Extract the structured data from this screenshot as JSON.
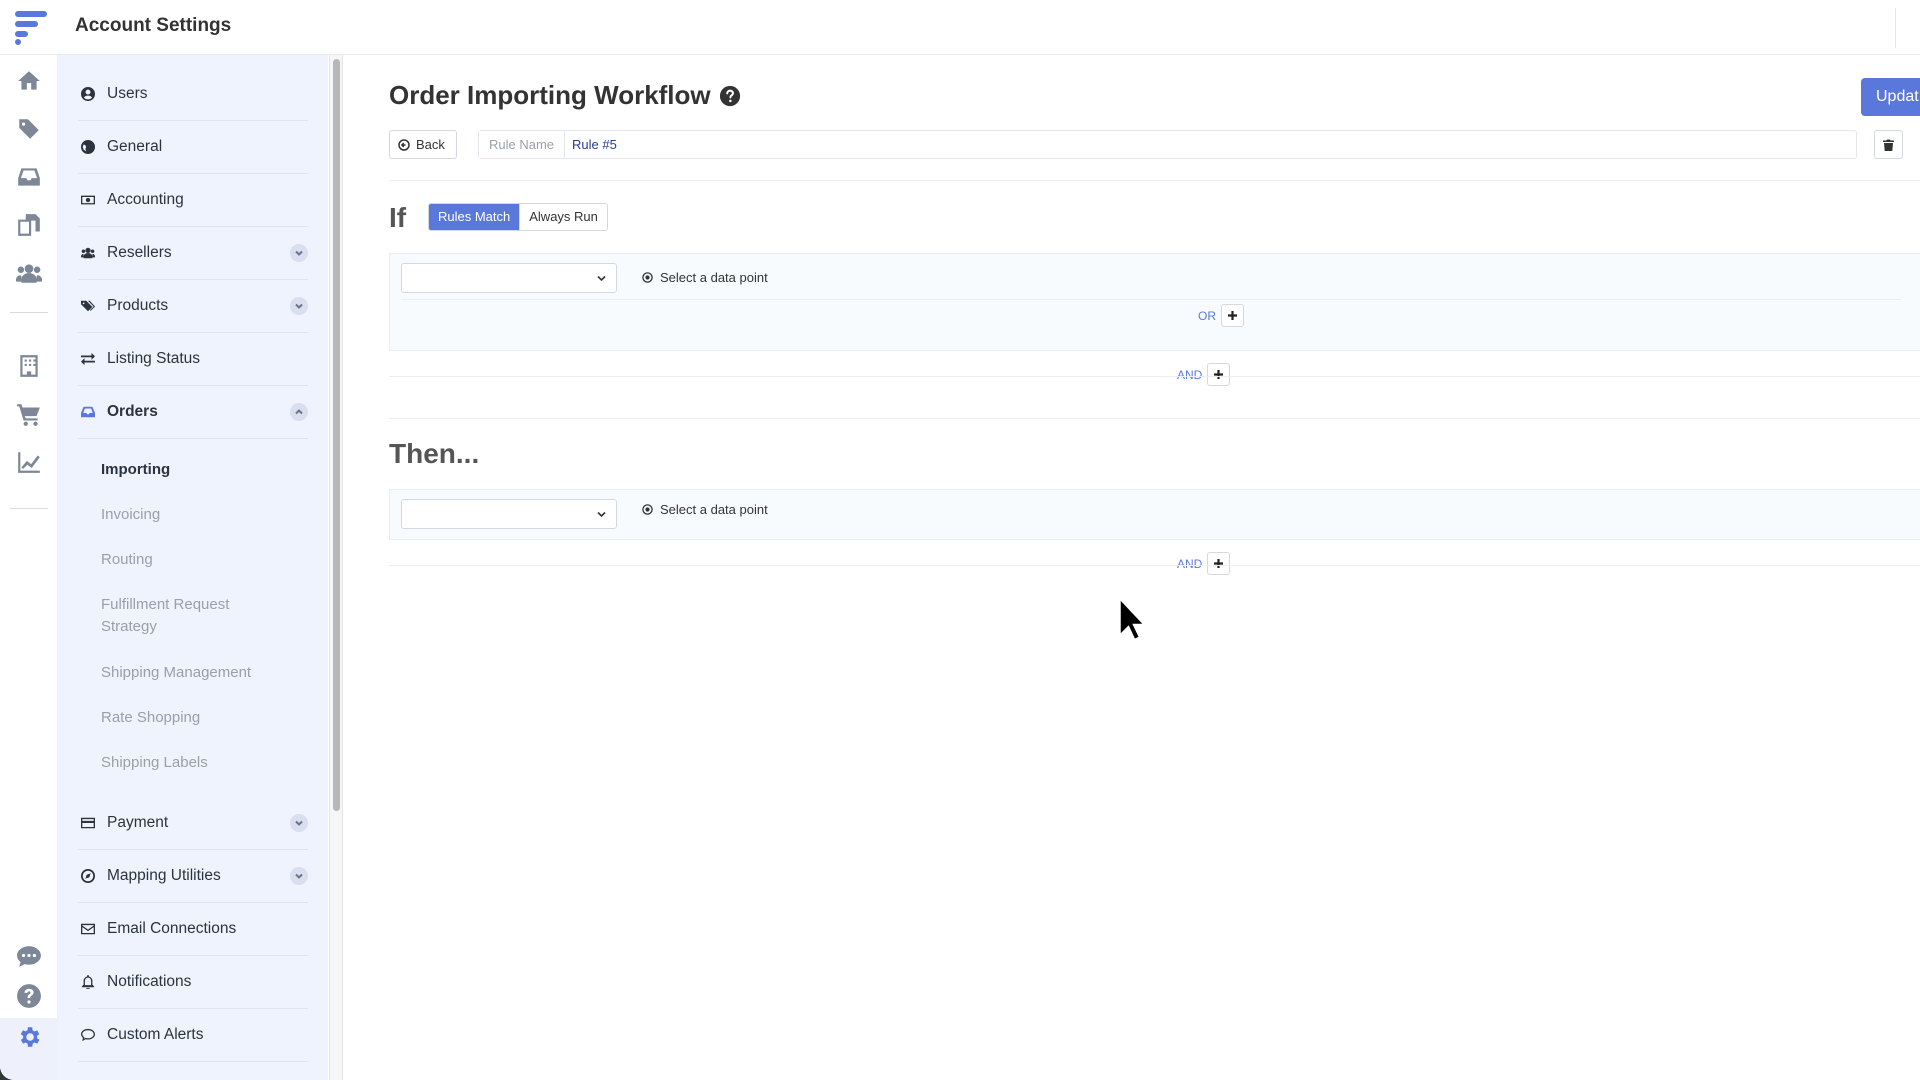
{
  "header": {
    "title": "Account Settings"
  },
  "rail": {
    "icons": [
      "home-icon",
      "tag-icon",
      "inbox-icon",
      "documents-icon",
      "users-icon",
      "building-icon",
      "cart-icon",
      "chart-icon",
      "chat-icon",
      "help-icon",
      "settings-icon"
    ],
    "active": "settings-icon"
  },
  "sidebar": {
    "items": [
      {
        "label": "Users",
        "icon": "user-circle-icon"
      },
      {
        "label": "General",
        "icon": "globe-icon"
      },
      {
        "label": "Accounting",
        "icon": "money-icon"
      },
      {
        "label": "Resellers",
        "icon": "users-icon",
        "expandable": true
      },
      {
        "label": "Products",
        "icon": "tags-icon",
        "expandable": true
      },
      {
        "label": "Listing Status",
        "icon": "exchange-icon"
      },
      {
        "label": "Orders",
        "icon": "inbox-icon",
        "expandable": true,
        "expanded": true
      }
    ],
    "orders_sub": [
      "Importing",
      "Invoicing",
      "Routing",
      "Fulfillment Request Strategy",
      "Shipping Management",
      "Rate Shopping",
      "Shipping Labels"
    ],
    "active_sub": "Importing",
    "items_after": [
      {
        "label": "Payment",
        "icon": "credit-card-icon",
        "expandable": true
      },
      {
        "label": "Mapping Utilities",
        "icon": "compass-icon",
        "expandable": true
      },
      {
        "label": "Email Connections",
        "icon": "envelope-icon"
      },
      {
        "label": "Notifications",
        "icon": "bell-icon"
      },
      {
        "label": "Custom Alerts",
        "icon": "comment-icon"
      }
    ]
  },
  "main": {
    "title": "Order Importing Workflow",
    "update_label": "Updat",
    "back_label": "Back",
    "rule_name_label": "Rule Name",
    "rule_name_value": "Rule #5",
    "if_label": "If",
    "mode_options": [
      "Rules Match",
      "Always Run"
    ],
    "mode_selected": "Rules Match",
    "if_condition": {
      "select_value": "",
      "datapoint_label": "Select a data point",
      "or_label": "OR"
    },
    "if_and_label": "AND",
    "then_label": "Then...",
    "then_action": {
      "select_value": "",
      "datapoint_label": "Select a data point"
    },
    "then_and_label": "AND"
  },
  "colors": {
    "accent": "#5a78dc",
    "sidebar_bg": "#eff3fd",
    "text": "#2c3340",
    "muted": "#9aa0ab"
  }
}
